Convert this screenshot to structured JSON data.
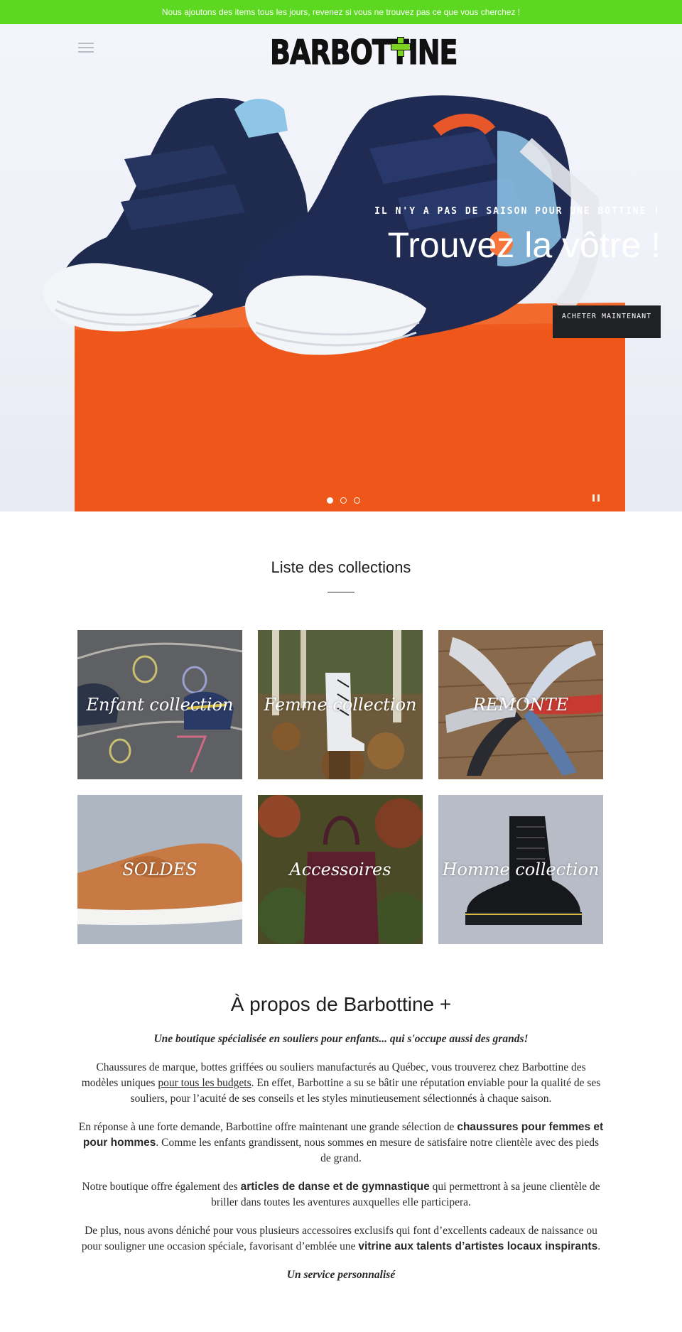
{
  "announcement": "Nous ajoutons des items tous les jours, revenez si vous ne trouvez pas ce que vous cherchez !",
  "header": {
    "logo_text": "BARBOTTINE",
    "menu_icon": "hamburger-icon"
  },
  "hero": {
    "subheading": "IL N'Y A PAS DE SAISON POUR UNE BOTTINE !",
    "title": "Trouvez la vôtre !",
    "button": "ACHETER MAINTENANT",
    "slides": 3,
    "active_slide": 1,
    "pause_icon": "pause-icon"
  },
  "collections": {
    "title": "Liste des collections",
    "items": [
      {
        "label": "Enfant collection"
      },
      {
        "label": "Femme collection"
      },
      {
        "label": "REMONTE"
      },
      {
        "label": "SOLDES"
      },
      {
        "label": "Accessoires"
      },
      {
        "label": "Homme collection"
      }
    ]
  },
  "about": {
    "title": "À propos de Barbottine +",
    "lead": "Une boutique spécialisée en souliers pour enfants... qui s'occupe aussi des grands!",
    "p1_a": "Chaussures de marque, bottes griffées ou souliers manufacturés au Québec, vous trouverez chez Barbottine des modèles uniques ",
    "p1_link": "pour tous les budgets",
    "p1_b": ". En effet, Barbottine a su se bâtir une réputation enviable pour la qualité de ses souliers, pour l’acuité de ses conseils et les styles minutieusement sélectionnés à chaque saison.",
    "p2_a": "En réponse à une forte demande, Barbottine offre maintenant une grande sélection de ",
    "p2_bold": "chaussures pour femmes et pour hommes",
    "p2_b": ". Comme les enfants grandissent, nous sommes en mesure de satisfaire notre clientèle avec des pieds de grand.",
    "p3_a": "Notre boutique offre également des ",
    "p3_bold": "articles de danse et de gymnastique",
    "p3_b": " qui permettront à sa jeune clientèle de briller dans toutes les aventures auxquelles elle participera.",
    "p4_a": "De plus, nous avons déniché pour vous plusieurs accessoires exclusifs qui font d’excellents cadeaux de naissance ou pour souligner une occasion spéciale, favorisant d’emblée une ",
    "p4_bold": "vitrine aux talents d’artistes locaux inspirants",
    "p4_b": ".",
    "subhead": "Un service personnalisé"
  },
  "colors": {
    "announcement_bg": "#5bd81f",
    "button_bg": "#1f2124",
    "box_orange": "#f05a1c",
    "shoe_navy": "#1e2a4e"
  }
}
